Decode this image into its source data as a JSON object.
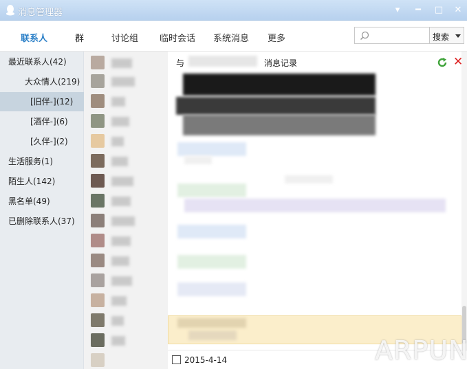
{
  "window": {
    "title": "消息管理器"
  },
  "tabs": [
    {
      "label": "联系人"
    },
    {
      "label": "群"
    },
    {
      "label": "讨论组"
    },
    {
      "label": "临时会话"
    },
    {
      "label": "系统消息"
    },
    {
      "label": "更多"
    }
  ],
  "search": {
    "button_label": "搜索",
    "value": ""
  },
  "sidebar": {
    "items": [
      {
        "label": "最近联系人(42)"
      },
      {
        "label": "大众情人(219)"
      },
      {
        "label": "[旧伴-](12)"
      },
      {
        "label": "[酒伴-](6)"
      },
      {
        "label": "[久伴-](2)"
      },
      {
        "label": "生活服务(1)"
      },
      {
        "label": "陌生人(142)"
      },
      {
        "label": "黑名单(49)"
      },
      {
        "label": "已删除联系人(37)"
      }
    ]
  },
  "main": {
    "header_prefix": "与",
    "header_suffix": "消息记录",
    "date": "2015-4-14"
  },
  "watermark": "ARPUN"
}
